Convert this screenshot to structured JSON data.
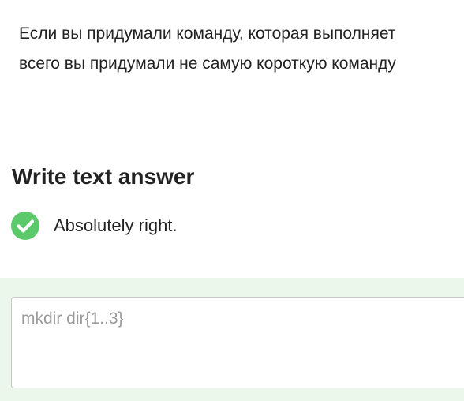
{
  "question": {
    "line1": "Если вы придумали команду, которая выполняет",
    "line2": "всего вы придумали не самую короткую команду"
  },
  "answer_section": {
    "title": "Write text answer",
    "feedback": "Absolutely right.",
    "feedback_icon": "check-circle-icon",
    "success_color": "#5cc96b",
    "answer_value": "mkdir dir{1..3}"
  }
}
